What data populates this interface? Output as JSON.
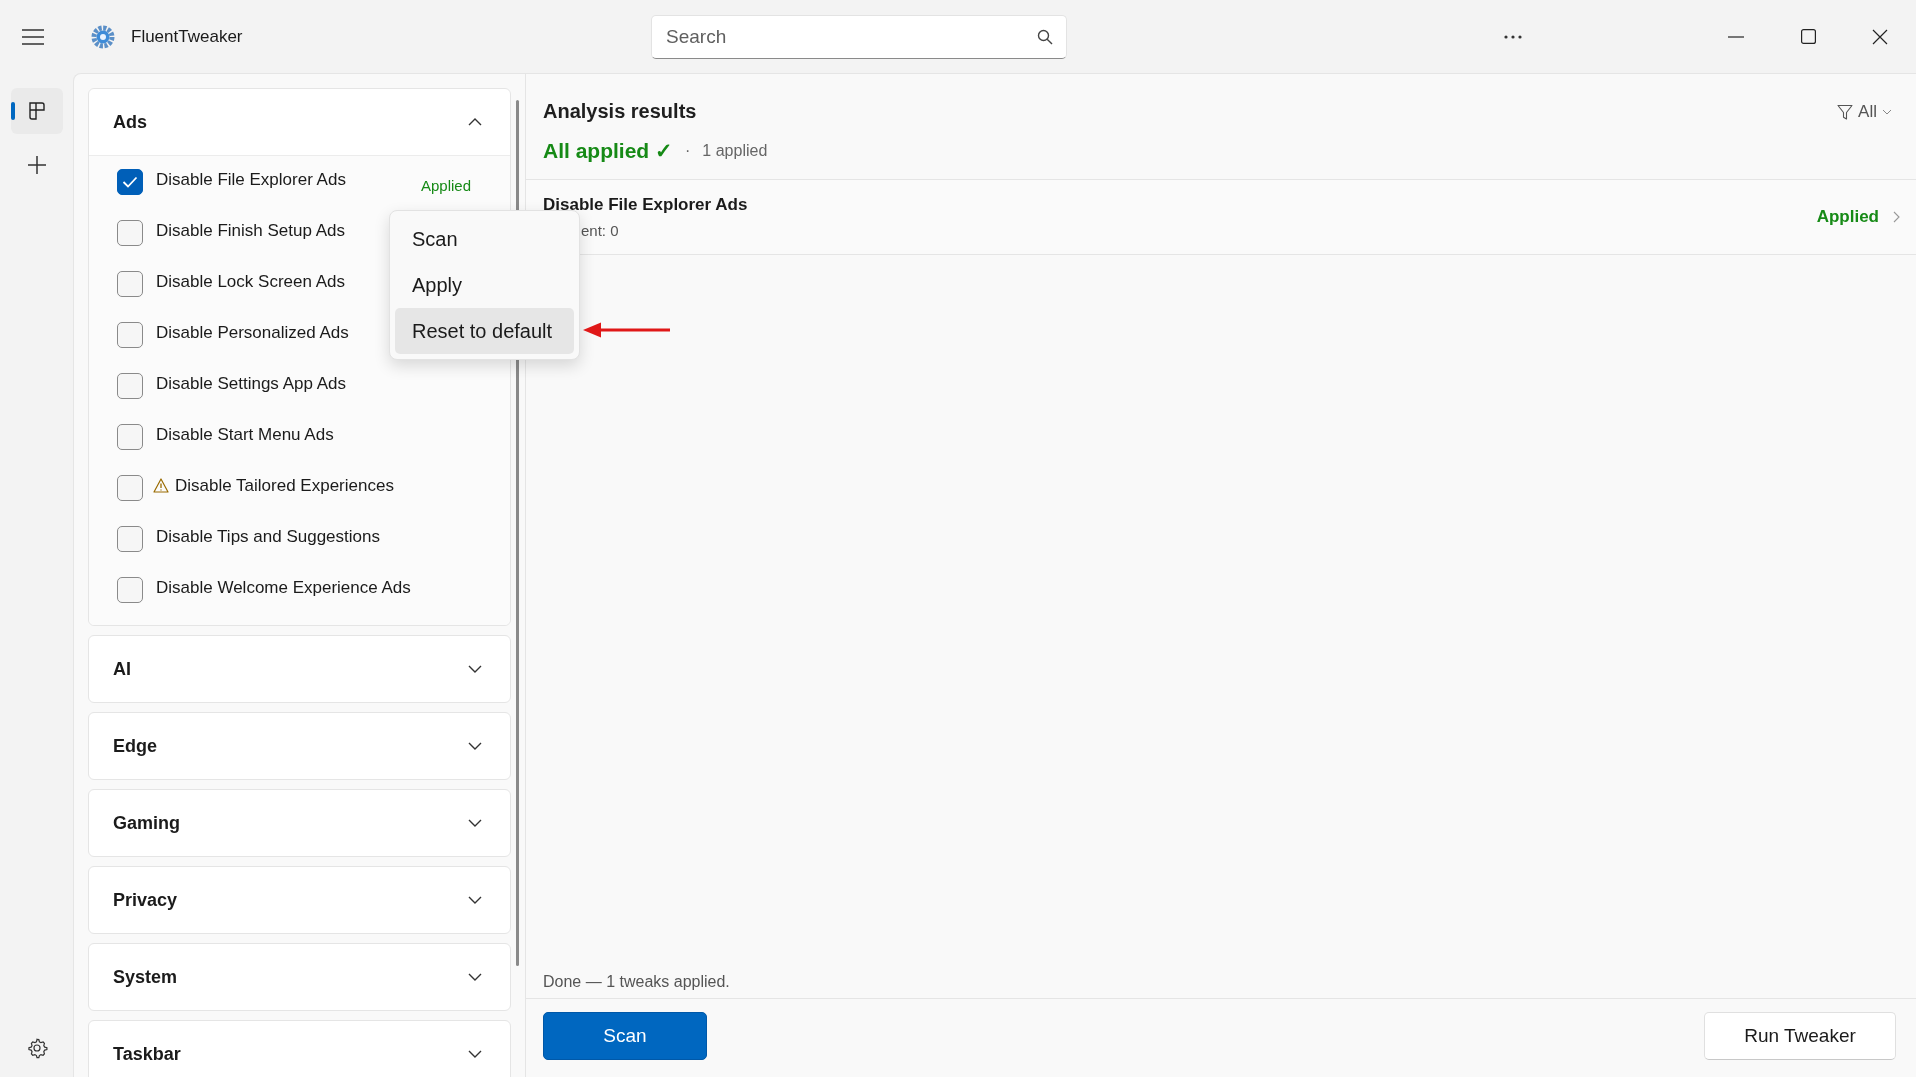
{
  "app": {
    "title": "FluentTweaker"
  },
  "search": {
    "placeholder": "Search"
  },
  "nav": [
    {
      "kind": "tweaks",
      "selected": true
    },
    {
      "kind": "add",
      "selected": false
    }
  ],
  "categories": [
    {
      "name": "Ads",
      "expanded": true,
      "tweaks": [
        {
          "label": "Disable File Explorer Ads",
          "checked": true,
          "warning": false,
          "status": "Applied"
        },
        {
          "label": "Disable Finish Setup Ads",
          "checked": false,
          "warning": false
        },
        {
          "label": "Disable Lock Screen Ads",
          "checked": false,
          "warning": false
        },
        {
          "label": "Disable Personalized Ads",
          "checked": false,
          "warning": false
        },
        {
          "label": "Disable Settings App Ads",
          "checked": false,
          "warning": false
        },
        {
          "label": "Disable Start Menu Ads",
          "checked": false,
          "warning": false
        },
        {
          "label": "Disable Tailored Experiences",
          "checked": false,
          "warning": true
        },
        {
          "label": "Disable Tips and Suggestions",
          "checked": false,
          "warning": false
        },
        {
          "label": "Disable Welcome Experience Ads",
          "checked": false,
          "warning": false
        }
      ]
    },
    {
      "name": "AI",
      "expanded": false
    },
    {
      "name": "Edge",
      "expanded": false
    },
    {
      "name": "Gaming",
      "expanded": false
    },
    {
      "name": "Privacy",
      "expanded": false
    },
    {
      "name": "System",
      "expanded": false
    },
    {
      "name": "Taskbar",
      "expanded": false
    }
  ],
  "results": {
    "title": "Analysis results",
    "summary": "All applied ✓",
    "separator": "·",
    "count": "1 applied",
    "filter": "All",
    "items": [
      {
        "name": "Disable File Explorer Ads",
        "detail": "ent: 0",
        "status": "Applied"
      }
    ]
  },
  "context_menu": {
    "items": [
      {
        "label": "Scan",
        "selected": false
      },
      {
        "label": "Apply",
        "selected": false
      },
      {
        "label": "Reset to default",
        "selected": true
      }
    ]
  },
  "status": "Done — 1 tweaks applied.",
  "buttons": [
    {
      "label": "Scan",
      "kind": "primary"
    },
    {
      "label": "Run Tweaker",
      "kind": "secondary"
    }
  ]
}
